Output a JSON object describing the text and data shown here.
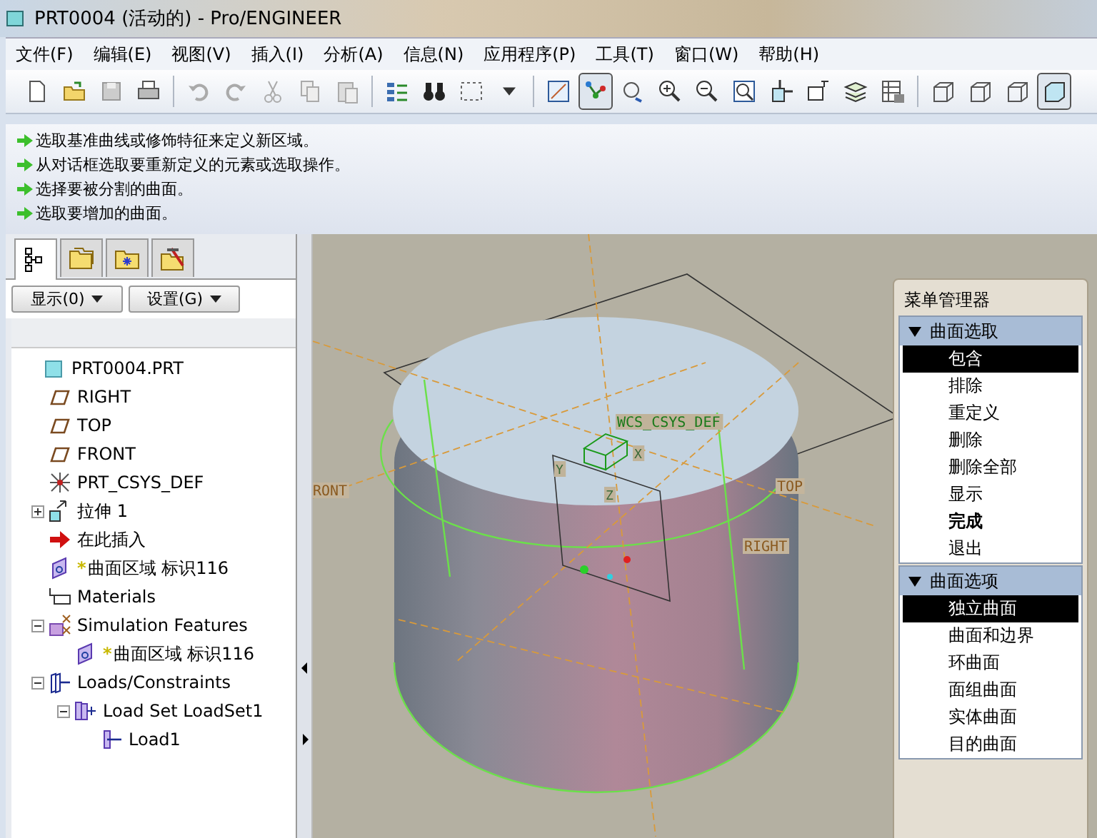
{
  "window": {
    "title": "PRT0004 (活动的) - Pro/ENGINEER"
  },
  "menu_bar": [
    "文件(F)",
    "编辑(E)",
    "视图(V)",
    "插入(I)",
    "分析(A)",
    "信息(N)",
    "应用程序(P)",
    "工具(T)",
    "窗口(W)",
    "帮助(H)"
  ],
  "toolbar": [
    {
      "selected": false
    },
    {
      "selected": false
    },
    {
      "selected": false
    },
    {
      "selected": false
    },
    {
      "selected": false
    },
    {
      "selected": false
    },
    {
      "selected": false
    },
    {
      "selected": false
    },
    {
      "selected": false
    },
    {
      "selected": false
    },
    {
      "selected": false
    },
    {
      "selected": false
    },
    {
      "selected": false
    },
    {
      "selected": false
    },
    {
      "selected": true
    },
    {
      "selected": false
    },
    {
      "selected": false
    },
    {
      "selected": false
    },
    {
      "selected": false
    },
    {
      "selected": false
    },
    {
      "selected": false
    },
    {
      "selected": false
    },
    {
      "selected": false
    },
    {
      "selected": false
    },
    {
      "selected": false
    },
    {
      "selected": false
    },
    {
      "selected": true
    }
  ],
  "messages": [
    "选取基准曲线或修饰特征来定义新区域。",
    "从对话框选取要重新定义的元素或选取操作。",
    "选择要被分割的曲面。",
    "选取要增加的曲面。"
  ],
  "model_tree": {
    "tabs": [
      {
        "selected": true
      },
      {
        "selected": false
      },
      {
        "selected": false
      },
      {
        "selected": false
      }
    ],
    "buttons": [
      "显示(0)",
      "设置(G)"
    ],
    "items": [
      {
        "label": "PRT0004.PRT",
        "kind": "part",
        "children": [
          {
            "label": "RIGHT",
            "kind": "plane"
          },
          {
            "label": "TOP",
            "kind": "plane"
          },
          {
            "label": "FRONT",
            "kind": "plane"
          },
          {
            "label": "PRT_CSYS_DEF",
            "kind": "csys"
          },
          {
            "label": "拉伸 1",
            "kind": "extrude",
            "expanded": false
          },
          {
            "label": "在此插入",
            "kind": "insert"
          },
          {
            "label": "曲面区域 标识116",
            "kind": "region",
            "marker": "*"
          },
          {
            "label": "Materials",
            "kind": "materials"
          },
          {
            "label": "Simulation Features",
            "kind": "simulation",
            "expanded": true,
            "children": [
              {
                "label": "曲面区域 标识116",
                "kind": "region",
                "marker": "*"
              }
            ]
          },
          {
            "label": "Loads/Constraints",
            "kind": "loads",
            "expanded": true,
            "children": [
              {
                "label": "Load Set LoadSet1",
                "kind": "loadset",
                "expanded": true,
                "children": [
                  {
                    "label": "Load1",
                    "kind": "load"
                  }
                ]
              }
            ]
          }
        ]
      }
    ]
  },
  "viewport": {
    "labels": [
      {
        "text": "WCS_CSYS_DEF",
        "kind": "csys"
      },
      {
        "text": "RONT",
        "kind": "datum"
      },
      {
        "text": "TOP",
        "kind": "datum"
      },
      {
        "text": "RIGHT",
        "kind": "datum"
      },
      {
        "text": "X",
        "kind": "axis"
      },
      {
        "text": "Y",
        "kind": "axis"
      },
      {
        "text": "Z",
        "kind": "axis"
      }
    ]
  },
  "menu_manager": {
    "title": "菜单管理器",
    "sections": [
      {
        "title": "曲面选取",
        "expanded": true,
        "items": [
          {
            "label": "包含",
            "selected": true,
            "bold": false
          },
          {
            "label": "排除",
            "selected": false,
            "bold": false
          },
          {
            "label": "重定义",
            "selected": false,
            "bold": false
          },
          {
            "label": "删除",
            "selected": false,
            "bold": false
          },
          {
            "label": "删除全部",
            "selected": false,
            "bold": false
          },
          {
            "label": "显示",
            "selected": false,
            "bold": false
          },
          {
            "label": "完成",
            "selected": false,
            "bold": true
          },
          {
            "label": "退出",
            "selected": false,
            "bold": false
          }
        ]
      },
      {
        "title": "曲面选项",
        "expanded": true,
        "items": [
          {
            "label": "独立曲面",
            "selected": true,
            "bold": false
          },
          {
            "label": "曲面和边界",
            "selected": false,
            "bold": false
          },
          {
            "label": "环曲面",
            "selected": false,
            "bold": false
          },
          {
            "label": "面组曲面",
            "selected": false,
            "bold": false
          },
          {
            "label": "实体曲面",
            "selected": false,
            "bold": false
          },
          {
            "label": "目的曲面",
            "selected": false,
            "bold": false
          }
        ]
      }
    ]
  }
}
